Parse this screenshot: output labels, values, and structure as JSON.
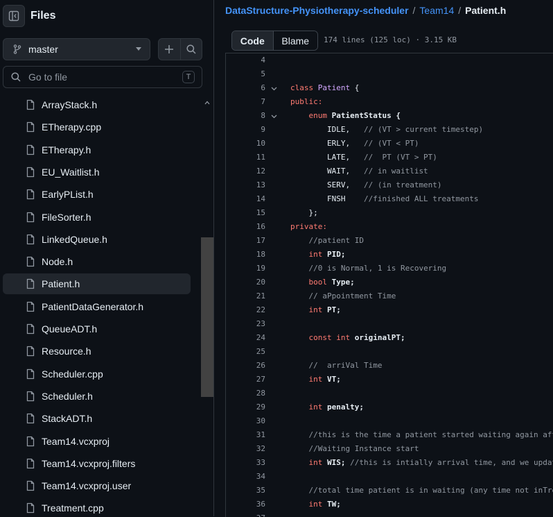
{
  "sidebar": {
    "title": "Files",
    "branch": "master",
    "search_placeholder": "Go to file",
    "search_shortcut": "T",
    "files": [
      "ArrayStack.h",
      "ETherapy.cpp",
      "ETherapy.h",
      "EU_Waitlist.h",
      "EarlyPList.h",
      "FileSorter.h",
      "LinkedQueue.h",
      "Node.h",
      "Patient.h",
      "PatientDataGenerator.h",
      "QueueADT.h",
      "Resource.h",
      "Scheduler.cpp",
      "Scheduler.h",
      "StackADT.h",
      "Team14.vcxproj",
      "Team14.vcxproj.filters",
      "Team14.vcxproj.user",
      "Treatment.cpp"
    ],
    "active_file": "Patient.h"
  },
  "breadcrumb": {
    "repo": "DataStructure-Physiotherapy-scheduler",
    "folder": "Team14",
    "file": "Patient.h",
    "sep": "/"
  },
  "toolbar": {
    "code_label": "Code",
    "blame_label": "Blame",
    "meta": "174 lines (125 loc) · 3.15 KB"
  },
  "code": {
    "lines": [
      {
        "n": "4",
        "fold": false,
        "parts": []
      },
      {
        "n": "5",
        "fold": false,
        "parts": []
      },
      {
        "n": "6",
        "fold": true,
        "parts": [
          {
            "t": "class ",
            "c": "kw"
          },
          {
            "t": "Patient",
            "c": "cls"
          },
          {
            "t": " {",
            "c": ""
          }
        ]
      },
      {
        "n": "7",
        "fold": false,
        "parts": [
          {
            "t": "public:",
            "c": "kw"
          }
        ]
      },
      {
        "n": "8",
        "fold": true,
        "parts": [
          {
            "t": "    ",
            "c": ""
          },
          {
            "t": "enum ",
            "c": "kw"
          },
          {
            "t": "PatientStatus {",
            "c": ""
          }
        ]
      },
      {
        "n": "9",
        "fold": false,
        "parts": [
          {
            "t": "        IDLE,   ",
            "c": ""
          },
          {
            "t": "// (VT > current timestep)",
            "c": "cm"
          }
        ]
      },
      {
        "n": "10",
        "fold": false,
        "parts": [
          {
            "t": "        ERLY,   ",
            "c": ""
          },
          {
            "t": "// (VT < PT)",
            "c": "cm"
          }
        ]
      },
      {
        "n": "11",
        "fold": false,
        "parts": [
          {
            "t": "        LATE,   ",
            "c": ""
          },
          {
            "t": "//  PT (VT > PT)",
            "c": "cm"
          }
        ]
      },
      {
        "n": "12",
        "fold": false,
        "parts": [
          {
            "t": "        WAIT,   ",
            "c": ""
          },
          {
            "t": "// in waitlist",
            "c": "cm"
          }
        ]
      },
      {
        "n": "13",
        "fold": false,
        "parts": [
          {
            "t": "        SERV,   ",
            "c": ""
          },
          {
            "t": "// (in treatment)",
            "c": "cm"
          }
        ]
      },
      {
        "n": "14",
        "fold": false,
        "parts": [
          {
            "t": "        FNSH    ",
            "c": ""
          },
          {
            "t": "//finished ALL treatments",
            "c": "cm"
          }
        ]
      },
      {
        "n": "15",
        "fold": false,
        "parts": [
          {
            "t": "    };",
            "c": ""
          }
        ]
      },
      {
        "n": "16",
        "fold": false,
        "parts": [
          {
            "t": "private:",
            "c": "kw"
          }
        ]
      },
      {
        "n": "17",
        "fold": false,
        "parts": [
          {
            "t": "    ",
            "c": ""
          },
          {
            "t": "//patient ID",
            "c": "cm"
          }
        ]
      },
      {
        "n": "18",
        "fold": false,
        "parts": [
          {
            "t": "    ",
            "c": ""
          },
          {
            "t": "int ",
            "c": "ty"
          },
          {
            "t": "PID;",
            "c": ""
          }
        ]
      },
      {
        "n": "19",
        "fold": false,
        "parts": [
          {
            "t": "    ",
            "c": ""
          },
          {
            "t": "//0 is Normal, 1 is Recovering",
            "c": "cm"
          }
        ]
      },
      {
        "n": "20",
        "fold": false,
        "parts": [
          {
            "t": "    ",
            "c": ""
          },
          {
            "t": "bool ",
            "c": "ty"
          },
          {
            "t": "Type;",
            "c": ""
          }
        ]
      },
      {
        "n": "21",
        "fold": false,
        "parts": [
          {
            "t": "    ",
            "c": ""
          },
          {
            "t": "// aPpointment Time",
            "c": "cm"
          }
        ]
      },
      {
        "n": "22",
        "fold": false,
        "parts": [
          {
            "t": "    ",
            "c": ""
          },
          {
            "t": "int ",
            "c": "ty"
          },
          {
            "t": "PT;",
            "c": ""
          }
        ]
      },
      {
        "n": "23",
        "fold": false,
        "parts": []
      },
      {
        "n": "24",
        "fold": false,
        "parts": [
          {
            "t": "    ",
            "c": ""
          },
          {
            "t": "const int ",
            "c": "ty"
          },
          {
            "t": "originalPT;",
            "c": ""
          }
        ]
      },
      {
        "n": "25",
        "fold": false,
        "parts": []
      },
      {
        "n": "26",
        "fold": false,
        "parts": [
          {
            "t": "    ",
            "c": ""
          },
          {
            "t": "//  arriVal Time",
            "c": "cm"
          }
        ]
      },
      {
        "n": "27",
        "fold": false,
        "parts": [
          {
            "t": "    ",
            "c": ""
          },
          {
            "t": "int ",
            "c": "ty"
          },
          {
            "t": "VT;",
            "c": ""
          }
        ]
      },
      {
        "n": "28",
        "fold": false,
        "parts": []
      },
      {
        "n": "29",
        "fold": false,
        "parts": [
          {
            "t": "    ",
            "c": ""
          },
          {
            "t": "int ",
            "c": "ty"
          },
          {
            "t": "penalty;",
            "c": ""
          }
        ]
      },
      {
        "n": "30",
        "fold": false,
        "parts": []
      },
      {
        "n": "31",
        "fold": false,
        "parts": [
          {
            "t": "    ",
            "c": ""
          },
          {
            "t": "//this is the time a patient started waiting again aft",
            "c": "cm"
          }
        ]
      },
      {
        "n": "32",
        "fold": false,
        "parts": [
          {
            "t": "    ",
            "c": ""
          },
          {
            "t": "//Waiting Instance start",
            "c": "cm"
          }
        ]
      },
      {
        "n": "33",
        "fold": false,
        "parts": [
          {
            "t": "    ",
            "c": ""
          },
          {
            "t": "int ",
            "c": "ty"
          },
          {
            "t": "WIS; ",
            "c": ""
          },
          {
            "t": "//this is intially arrival time, and we updat",
            "c": "cm"
          }
        ]
      },
      {
        "n": "34",
        "fold": false,
        "parts": []
      },
      {
        "n": "35",
        "fold": false,
        "parts": [
          {
            "t": "    ",
            "c": ""
          },
          {
            "t": "//total time patient is in waiting (any time not inTre",
            "c": "cm"
          }
        ]
      },
      {
        "n": "36",
        "fold": false,
        "parts": [
          {
            "t": "    ",
            "c": ""
          },
          {
            "t": "int ",
            "c": "ty"
          },
          {
            "t": "TW;",
            "c": ""
          }
        ]
      },
      {
        "n": "37",
        "fold": false,
        "parts": []
      }
    ]
  },
  "colors": {
    "bg": "#0d1117",
    "border": "#30363d",
    "link": "#4493f8",
    "keyword": "#ff7b72",
    "class_name": "#d2a8ff",
    "comment": "#9198a1"
  },
  "icons": {
    "panel": "sidebar-collapse-icon",
    "branch": "git-branch-icon",
    "add": "plus-icon",
    "search": "search-icon",
    "file": "file-icon",
    "fold": "chevron-down-icon"
  }
}
